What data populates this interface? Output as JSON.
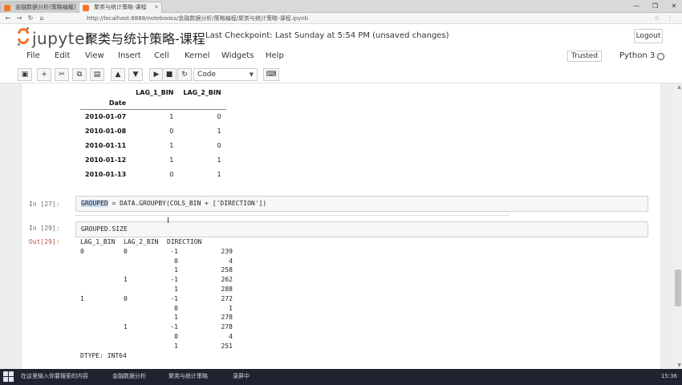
{
  "browser": {
    "tabs": [
      {
        "label": "金融数据分析(策略编程)(策略)",
        "active": false
      },
      {
        "label": "聚类与统计策略-课程",
        "active": true
      }
    ],
    "url": "http://localhost:8888/notebooks/金融数据分析/策略编程/聚类与统计策略-课程.ipynb",
    "window_controls": [
      "—",
      "❐",
      "✕"
    ]
  },
  "header": {
    "logo_text": "jupyter",
    "notebook_title": "聚类与统计策略-课程",
    "checkpoint": "Last Checkpoint: Last Sunday at 5:54 PM (unsaved changes)",
    "logout": "Logout"
  },
  "menu": {
    "items": [
      "File",
      "Edit",
      "View",
      "Insert",
      "Cell",
      "Kernel",
      "Widgets",
      "Help"
    ],
    "trusted": "Trusted",
    "kernel": "Python 3"
  },
  "toolbar": {
    "cell_type": "Code",
    "icons": [
      "save-icon",
      "plus-icon",
      "cut-icon",
      "copy-icon",
      "paste-icon",
      "arrow-up-icon",
      "arrow-down-icon",
      "run-icon",
      "stop-icon",
      "restart-icon",
      "keyboard-icon"
    ]
  },
  "dataframe": {
    "columns": [
      "LAG_1_BIN",
      "LAG_2_BIN"
    ],
    "index_name": "Date",
    "rows": [
      {
        "date": "2010-01-07",
        "lag1": "1",
        "lag2": "0"
      },
      {
        "date": "2010-01-08",
        "lag1": "0",
        "lag2": "1"
      },
      {
        "date": "2010-01-11",
        "lag1": "1",
        "lag2": "0"
      },
      {
        "date": "2010-01-12",
        "lag1": "1",
        "lag2": "1"
      },
      {
        "date": "2010-01-13",
        "lag1": "0",
        "lag2": "1"
      }
    ]
  },
  "cells": [
    {
      "prompt": "In [27]:",
      "code_hl": "GROUPED",
      "code_rest": " = DATA.GROUPBY(COLS_BIN + ['DIRECTION'])"
    },
    {
      "prompt": "In [29]:",
      "code": "GROUPED.SIZE"
    }
  ],
  "output": {
    "prompt": "Out[29]:",
    "header": [
      "LAG_1_BIN",
      "LAG_2_BIN",
      "DIRECTION",
      ""
    ],
    "rows": [
      [
        "0",
        "0",
        "-1",
        "239"
      ],
      [
        "",
        "",
        "0",
        "4"
      ],
      [
        "",
        "",
        "1",
        "258"
      ],
      [
        "",
        "1",
        "-1",
        "262"
      ],
      [
        "",
        "",
        "1",
        "288"
      ],
      [
        "1",
        "0",
        "-1",
        "272"
      ],
      [
        "",
        "",
        "0",
        "1"
      ],
      [
        "",
        "",
        "1",
        "278"
      ],
      [
        "",
        "1",
        "-1",
        "278"
      ],
      [
        "",
        "",
        "0",
        "4"
      ],
      [
        "",
        "",
        "1",
        "251"
      ]
    ],
    "dtype": "DTYPE: INT64"
  },
  "taskbar": {
    "items": [
      "在这里输入你要搜索的内容",
      "金融数据分析",
      "聚类与统计策略",
      "录屏中"
    ],
    "tray": "15:36"
  }
}
